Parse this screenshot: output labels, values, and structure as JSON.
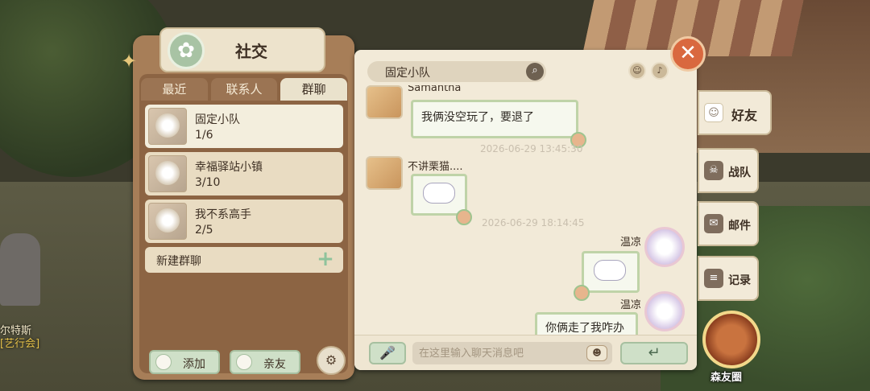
{
  "background": {
    "npc_name": "尔特斯",
    "npc_guild": "[艺行会]"
  },
  "panel": {
    "title": "社交",
    "tabs": [
      {
        "label": "最近"
      },
      {
        "label": "联系人"
      },
      {
        "label": "群聊"
      }
    ],
    "groups": [
      {
        "name": "固定小队",
        "count": "1/6"
      },
      {
        "name": "幸福驿站小镇",
        "count": "3/10"
      },
      {
        "name": "我不系高手",
        "count": "2/5"
      }
    ],
    "new_group_label": "新建群聊",
    "add_label": "添加",
    "friends_label": "亲友"
  },
  "chat": {
    "title": "固定小队",
    "messages": {
      "m1_sender": "Samantha",
      "m1_text": "我俩没空玩了，要退了",
      "ts1": "2026-06-29 13:45:30",
      "m2_sender": "不讲栗猫....",
      "ts2": "2026-06-29 18:14:45",
      "m3_sender": "温凉",
      "m4_sender": "温凉",
      "m4_text": "你俩走了我咋办"
    },
    "input_placeholder": "在这里输入聊天消息吧"
  },
  "sidebar": {
    "tabs": [
      {
        "label": "好友"
      },
      {
        "label": "战队"
      },
      {
        "label": "邮件"
      },
      {
        "label": "记录"
      }
    ],
    "forest_label": "森友圈"
  },
  "colors": {
    "panel_brown": "#a77e58",
    "chat_bg": "#f2ead8",
    "bubble_border": "#bfd3a8",
    "close_orange": "#d9683f"
  },
  "icons": [
    "clover-icon",
    "search-icon",
    "mic-icon",
    "send-icon",
    "close-icon",
    "plus-icon",
    "settings-icon"
  ]
}
